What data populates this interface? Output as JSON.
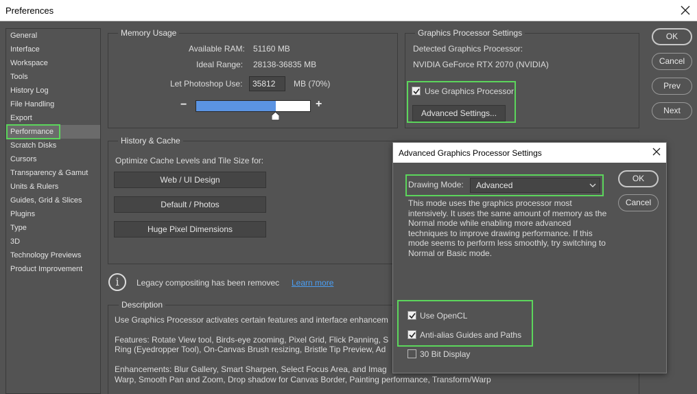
{
  "window": {
    "title": "Preferences"
  },
  "sidebar": {
    "items": [
      {
        "label": "General"
      },
      {
        "label": "Interface"
      },
      {
        "label": "Workspace"
      },
      {
        "label": "Tools"
      },
      {
        "label": "History Log"
      },
      {
        "label": "File Handling"
      },
      {
        "label": "Export"
      },
      {
        "label": "Performance",
        "selected": true
      },
      {
        "label": "Scratch Disks"
      },
      {
        "label": "Cursors"
      },
      {
        "label": "Transparency & Gamut"
      },
      {
        "label": "Units & Rulers"
      },
      {
        "label": "Guides, Grid & Slices"
      },
      {
        "label": "Plugins"
      },
      {
        "label": "Type"
      },
      {
        "label": "3D"
      },
      {
        "label": "Technology Previews"
      },
      {
        "label": "Product Improvement"
      }
    ]
  },
  "memory": {
    "title": "Memory Usage",
    "available_label": "Available RAM:",
    "available_value": "51160 MB",
    "ideal_label": "Ideal Range:",
    "ideal_value": "28138-36835 MB",
    "let_use_label": "Let Photoshop Use:",
    "let_use_value": "35812",
    "let_use_unit": "MB (70%)",
    "minus": "−",
    "plus": "+",
    "slider_fraction": 0.7
  },
  "gpu": {
    "title": "Graphics Processor Settings",
    "detected_label": "Detected Graphics Processor:",
    "detected_value": "NVIDIA GeForce RTX 2070 (NVIDIA)",
    "use_gpu_label": "Use Graphics Processor",
    "use_gpu_checked": true,
    "advanced_button": "Advanced Settings..."
  },
  "history": {
    "title": "History & Cache",
    "optimize_label": "Optimize Cache Levels and Tile Size for:",
    "buttons": [
      "Web / UI Design",
      "Default / Photos",
      "Huge Pixel Dimensions"
    ]
  },
  "legacy": {
    "text": "Legacy compositing has been removec",
    "link": "Learn more"
  },
  "description": {
    "title": "Description",
    "line1": "Use Graphics Processor activates certain features and interface enhancem",
    "line2": "Features: Rotate View tool, Birds-eye zooming, Pixel Grid, Flick Panning, S",
    "line3": "Ring (Eyedropper Tool), On-Canvas Brush resizing, Bristle Tip Preview, Ad",
    "line4": "Enhancements: Blur Gallery, Smart Sharpen, Select Focus Area, and Imag",
    "line5": "Warp, Smooth Pan and Zoom, Drop shadow for Canvas Border, Painting performance, Transform/Warp"
  },
  "buttons": {
    "ok": "OK",
    "cancel": "Cancel",
    "prev": "Prev",
    "next": "Next"
  },
  "dialog": {
    "title": "Advanced Graphics Processor Settings",
    "drawing_mode_label": "Drawing Mode:",
    "drawing_mode_value": "Advanced",
    "mode_description": "This mode uses the graphics processor most intensively.  It uses the same amount of memory as the Normal mode while enabling more advanced techniques to improve drawing performance.  If this mode seems to perform less smoothly, try switching to Normal or Basic mode.",
    "ok": "OK",
    "cancel": "Cancel",
    "opencl_label": "Use OpenCL",
    "opencl_checked": true,
    "antialias_label": "Anti-alias Guides and Paths",
    "antialias_checked": true,
    "bit30_label": "30 Bit Display",
    "bit30_checked": false
  },
  "colors": {
    "highlight": "#5cd65c",
    "slider_fill": "#5b94e3",
    "link": "#4a9ff5",
    "panel_bg": "#535353"
  }
}
